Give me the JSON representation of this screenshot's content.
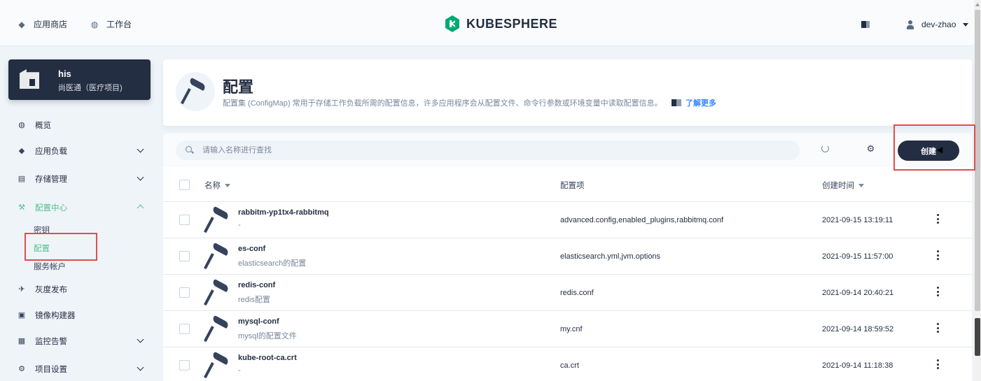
{
  "topbar": {
    "app_store": "应用商店",
    "workbench": "工作台",
    "logo_text": "KUBESPHERE",
    "username": "dev-zhao"
  },
  "project": {
    "name": "his",
    "description": "尚医通（医疗项目)"
  },
  "sidebar": {
    "items": [
      {
        "label": "概览",
        "icon": "dashboard-icon"
      },
      {
        "label": "应用负载",
        "icon": "appstore-icon"
      },
      {
        "label": "存储管理",
        "icon": "database-icon"
      },
      {
        "label": "配置中心",
        "icon": "hammer-icon"
      },
      {
        "label": "灰度发布",
        "icon": "bird-icon"
      },
      {
        "label": "镜像构建器",
        "icon": "image-builder-icon"
      },
      {
        "label": "监控告警",
        "icon": "monitor-icon"
      },
      {
        "label": "项目设置",
        "icon": "gear-icon"
      }
    ],
    "config_sub": [
      {
        "label": "密钥"
      },
      {
        "label": "配置"
      },
      {
        "label": "服务帐户"
      }
    ]
  },
  "header": {
    "title": "配置",
    "description": "配置集 (ConfigMap) 常用于存储工作负载所需的配置信息，许多应用程序会从配置文件、命令行参数或环境变量中读取配置信息。",
    "learn_more": "了解更多"
  },
  "toolbar": {
    "search_placeholder": "请输入名称进行查找",
    "create_label": "创建"
  },
  "table": {
    "columns": {
      "name": "名称",
      "items": "配置项",
      "created": "创建时间"
    },
    "rows": [
      {
        "name": "rabbitm-yp1tx4-rabbitmq",
        "description": "-",
        "items": "advanced.config,enabled_plugins,rabbitmq.conf",
        "created": "2021-09-15 13:19:11"
      },
      {
        "name": "es-conf",
        "description": "elasticsearch的配置",
        "items": "elasticsearch.yml,jvm.options",
        "created": "2021-09-15 11:57:00"
      },
      {
        "name": "redis-conf",
        "description": "redis配置",
        "items": "redis.conf",
        "created": "2021-09-14 20:40:21"
      },
      {
        "name": "mysql-conf",
        "description": "mysql的配置文件",
        "items": "my.cnf",
        "created": "2021-09-14 18:59:52"
      },
      {
        "name": "kube-root-ca.crt",
        "description": "-",
        "items": "ca.crt",
        "created": "2021-09-14 11:18:38"
      }
    ]
  },
  "colors": {
    "brand_dark": "#242e42",
    "accent_green": "#55bc8a",
    "highlight_red": "#e34c4c",
    "logo_green": "#00aa72"
  }
}
